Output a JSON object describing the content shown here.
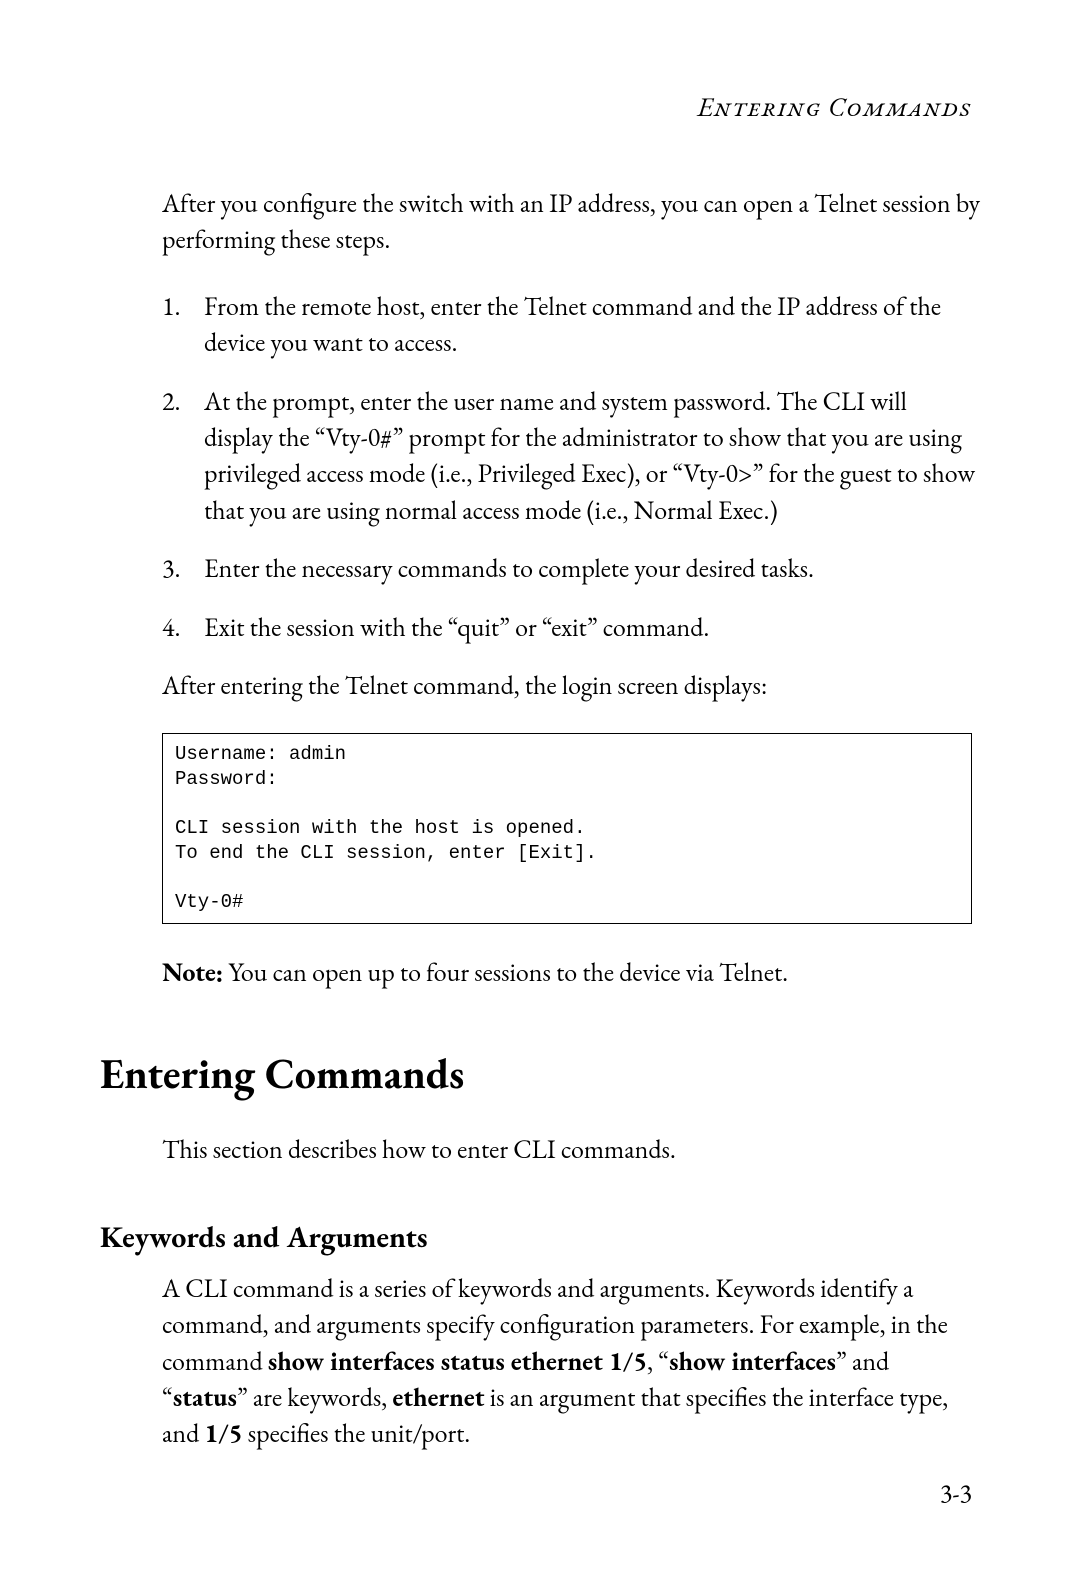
{
  "header": {
    "runningTitle": "Entering Commands"
  },
  "intro": "After you configure the switch with an IP address, you can open a Telnet session by performing these steps.",
  "steps": [
    {
      "num": "1.",
      "text": "From the remote host, enter the Telnet command and the IP address of the device you want to access."
    },
    {
      "num": "2.",
      "text": "At the prompt, enter the user name and system password. The CLI will display the “Vty-0#” prompt for the administrator to show that you are using privileged access mode (i.e., Privileged Exec), or “Vty-0>” for the guest to show that you are using normal access mode (i.e., Normal Exec.)"
    },
    {
      "num": "3.",
      "text": "Enter the necessary commands to complete your desired tasks."
    },
    {
      "num": "4.",
      "text": "Exit the session with the “quit” or “exit” command."
    }
  ],
  "afterSteps": "After entering the Telnet command, the login screen displays:",
  "codeBlock": "Username: admin\nPassword:\n\nCLI session with the host is opened.\nTo end the CLI session, enter [Exit].\n\nVty-0#",
  "note": {
    "label": "Note:",
    "text": "  You can open up to four sessions to the device via Telnet."
  },
  "section": {
    "title": "Entering Commands",
    "intro": "This section describes how to enter CLI commands."
  },
  "subsection": {
    "title": "Keywords and Arguments",
    "parts": {
      "p1": "A CLI command is a series of keywords and arguments. Keywords identify a command, and arguments specify configuration parameters. For example, in the command ",
      "b1": "show interfaces status ethernet 1/5",
      "p2": ", “",
      "b2": "show interfaces",
      "p3": "” and “",
      "b3": "status",
      "p4": "” are keywords, ",
      "b4": "ethernet",
      "p5": " is an argument that specifies the interface type, and ",
      "b5": "1/5",
      "p6": " specifies the unit/port."
    }
  },
  "pageNumber": "3-3"
}
